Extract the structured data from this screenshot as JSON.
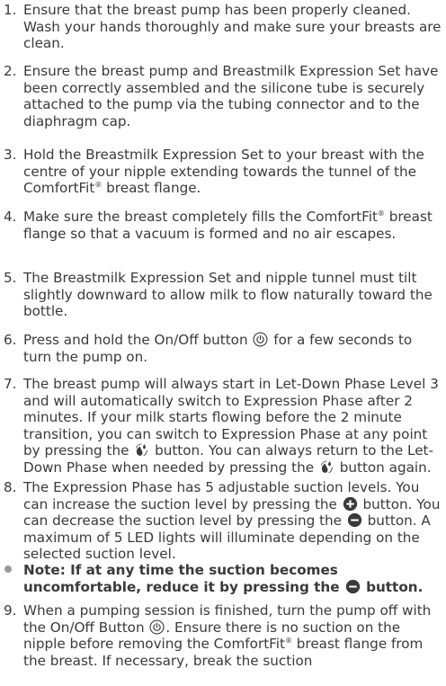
{
  "items": [
    {
      "num": "1.",
      "text": "Ensure that the breast pump has been properly cleaned. Wash your hands thoroughly and make sure your breasts are clean."
    },
    {
      "num": "2.",
      "text": "Ensure the breast pump and Breastmilk Expression Set have been correctly assembled and the silicone tube is securely attached to the pump via the tubing connector and to the diaphragm cap."
    },
    {
      "num": "3.",
      "text_a": "Hold the Breastmilk Expression Set to your breast with the centre of your nipple extending towards the tunnel of the ComfortFit",
      "reg": "®",
      "text_b": " breast flange."
    },
    {
      "num": "4.",
      "text_a": "Make sure the breast completely fills the ComfortFit",
      "reg": "®",
      "text_b": " breast flange so that a vacuum is formed and no air escapes."
    },
    {
      "num": "5.",
      "text": "The Breastmilk Expression Set and nipple tunnel must tilt slightly downward to allow milk to flow naturally toward the bottle."
    },
    {
      "num": "6.",
      "text_a": "Press and hold the On/Off button ",
      "text_b": " for a few seconds to turn the pump on."
    },
    {
      "num": "7.",
      "text_a": "The breast pump will always start in Let-Down Phase Level 3 and will automatically switch to Expression Phase after 2 minutes. If your milk starts flowing before the 2 minute transition, you can switch to Expression Phase at any point by pressing the ",
      "text_b": " button. You can always return to the Let-Down Phase when needed by pressing the ",
      "text_c": " button again."
    },
    {
      "num": "8.",
      "text_a": "The Expression Phase has 5 adjustable suction levels. You can increase the suction level by pressing the ",
      "text_b": " button. You can decrease the suction level by pressing the ",
      "text_c": " button. A maximum of 5 LED lights will illuminate depending on the selected suction level."
    },
    {
      "num": "",
      "text_a": "Note: If at any time the suction becomes uncomfortable, reduce it by pressing the ",
      "text_b": " button."
    },
    {
      "num": "9.",
      "text_a": "When a pumping session is finished, turn the pump off with the On/Off Button ",
      "text_b": ". Ensure there is no suction on the nipple before removing the ComfortFit",
      "reg": "®",
      "text_c": " breast flange from the breast. If necessary, break the suction"
    }
  ],
  "colors": {
    "text": "#3a3a3a",
    "icon": "#3a3a3a",
    "bullet": "#9a9a9a"
  },
  "icons": [
    "power-icon",
    "milk-drop-icon",
    "plus-icon",
    "minus-icon"
  ]
}
